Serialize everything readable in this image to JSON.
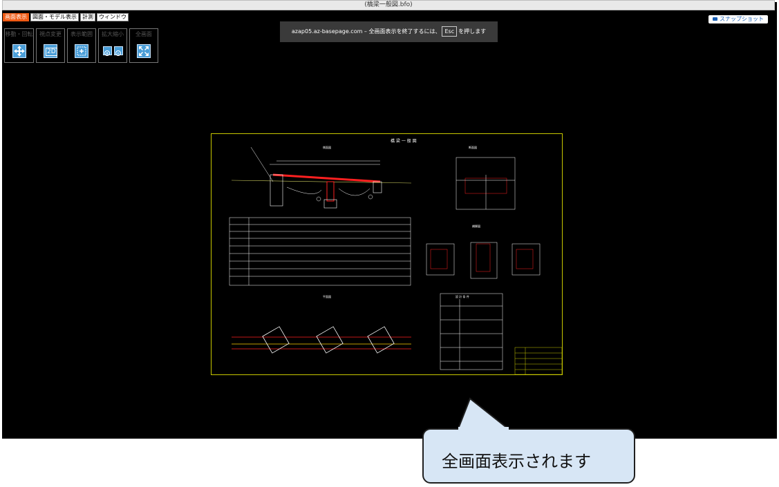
{
  "window": {
    "title": "(橋梁一般図.bfo)"
  },
  "menu": {
    "items": [
      {
        "label": "画面表示",
        "active": true
      },
      {
        "label": "図面・モデル表示",
        "active": false
      },
      {
        "label": "計測",
        "active": false
      },
      {
        "label": "ウィンドウ",
        "active": false
      }
    ]
  },
  "toolbar": {
    "groups": [
      {
        "label": "移動・回転",
        "icon": "move-arrows-icon"
      },
      {
        "label": "視点変更",
        "icon": "2d-view-icon"
      },
      {
        "label": "表示範囲",
        "icon": "fit-range-icon"
      },
      {
        "label": "拡大縮小",
        "icon": "zoom-icon"
      },
      {
        "label": "全画面",
        "icon": "fullscreen-icon"
      }
    ],
    "view_2d_label": "2D"
  },
  "snapshot": {
    "label": "スナップショット",
    "icon": "camera-icon"
  },
  "notice": {
    "text_before": "azap05.az-basepage.com – 全画面表示を終了するには、",
    "key": "Esc",
    "text_after": "を押します"
  },
  "drawing": {
    "title": "橋 梁 一 般 図",
    "side_view": "側面図",
    "section_view": "断面図",
    "pier_view": "橋脚図",
    "plan_view": "平面図",
    "spec_title": "設 計 条 件"
  },
  "callout": {
    "text": "全画面表示されます"
  },
  "colors": {
    "accent": "#f05a14",
    "tool": "#4a9ed8",
    "callout_fill": "#d7e6f5",
    "drawing_frame": "#c8c800"
  }
}
